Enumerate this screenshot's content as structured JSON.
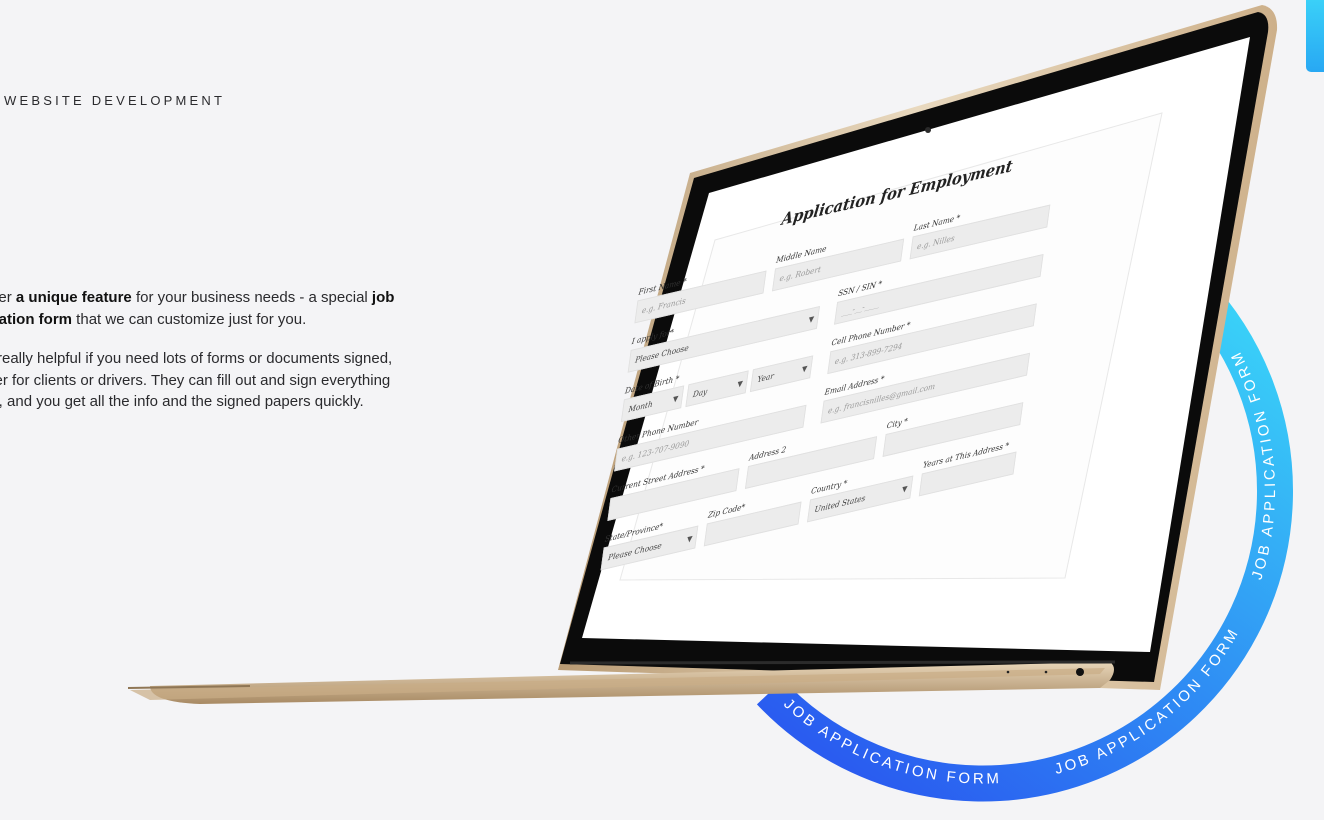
{
  "header": {
    "section_label": "WEBSITE DEVELOPMENT"
  },
  "copy": {
    "p1_a": "offer ",
    "p1_b": "a unique feature",
    "p1_c": " for your business needs - a special ",
    "p1_d": "job",
    "p1_e": "lication form",
    "p1_f": " that we can customize just for you.",
    "p2_l1": "is really helpful if you need lots of forms or documents signed,",
    "p2_l2": "ther for clients or drivers. They can fill out and sign everything",
    "p2_l3": "ne, and you get all the info and the signed papers quickly."
  },
  "ring": {
    "text": "JOB APPLICATION FORM",
    "color_start": "#36d2f8",
    "color_end": "#2a5cf0"
  },
  "form": {
    "title": "Application for Employment",
    "first_name": {
      "label": "First Name *",
      "placeholder": "e.g. Francis"
    },
    "middle_name": {
      "label": "Middle Name",
      "placeholder": "e.g. Robert"
    },
    "last_name": {
      "label": "Last Name *",
      "placeholder": "e.g. Nilles"
    },
    "apply_for": {
      "label": "I apply for*",
      "value": "Please Choose"
    },
    "ssn": {
      "label": "SSN / SIN *",
      "placeholder": "___-__-____"
    },
    "dob": {
      "label": "Date of Birth *",
      "month": "Month",
      "day": "Day",
      "year": "Year"
    },
    "cell_phone": {
      "label": "Cell Phone Number *",
      "placeholder": "e.g. 313-899-7294"
    },
    "other_phone": {
      "label": "Other Phone Number",
      "placeholder": "e.g. 123-707-9090"
    },
    "email": {
      "label": "Email Address *",
      "placeholder": "e.g. francisnilles@gmail.com"
    },
    "street": {
      "label": "Current Street Address *"
    },
    "address2": {
      "label": "Address 2"
    },
    "city": {
      "label": "City *"
    },
    "state": {
      "label": "State/Province*",
      "value": "Please Choose"
    },
    "zip": {
      "label": "Zip Code*"
    },
    "country": {
      "label": "Country *",
      "value": "United States"
    },
    "years": {
      "label": "Years at This Address *"
    }
  }
}
